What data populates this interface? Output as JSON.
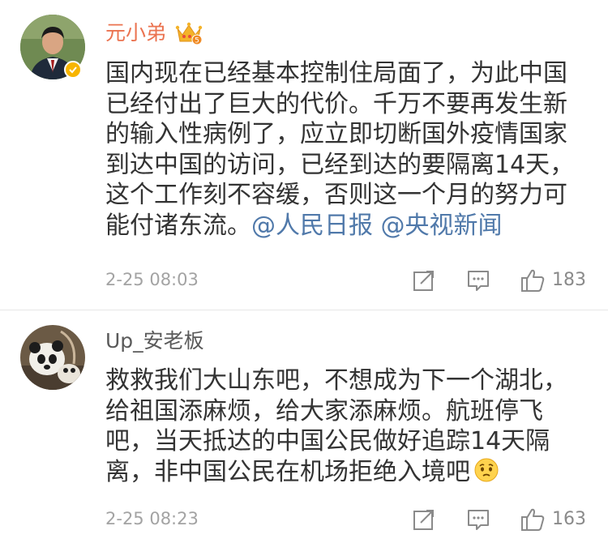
{
  "comments": [
    {
      "username": "元小弟",
      "verified": true,
      "badge_icon": "vip-crown-icon",
      "lines": [
        "国内现在已经基本控制住局面了，为此中国",
        "已经付出了巨大的代价。千万不要再发生新",
        "的输入性病例了，应立即切断国外疫情国家",
        "到达中国的访问，已经到达的要隔离14天，",
        "这个工作刻不容缓，否则这一个月的努力可",
        "能付诸东流。"
      ],
      "mentions": [
        "@人民日报",
        "@央视新闻"
      ],
      "time": "2-25 08:03",
      "likes": "183"
    },
    {
      "username": "Up_安老板",
      "lines": [
        "救救我们大山东吧，不想成为下一个湖北，",
        "给祖国添麻烦，给大家添麻烦。航班停飞",
        "吧，当天抵达的中国公民做好追踪14天隔",
        "离，非中国公民在机场拒绝入境吧"
      ],
      "emoji": "worried-face-emoji",
      "time": "2-25 08:23",
      "likes": "163"
    }
  ],
  "colors": {
    "username_vip": "#eb7350",
    "username_normal": "#5a5a5a",
    "mention": "#5079aa",
    "body_text": "#333333",
    "meta_text": "#a3a3a3",
    "verified_badge": "#f7b500",
    "divider": "#e6e6e6"
  },
  "icons": [
    "share-icon",
    "reply-icon",
    "like-icon"
  ]
}
